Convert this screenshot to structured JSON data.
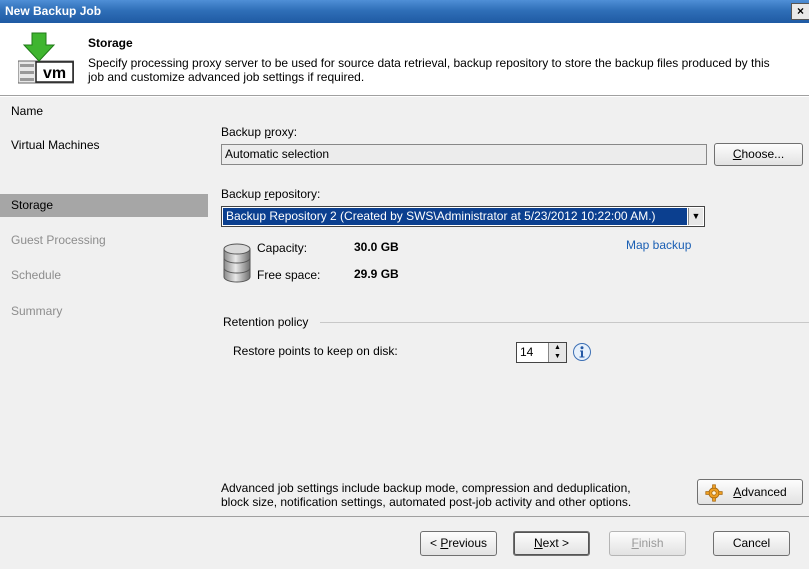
{
  "window": {
    "title": "New Backup Job",
    "close_label": "×"
  },
  "header": {
    "title": "Storage",
    "description_line1": "Specify processing proxy server to be used for source data retrieval, backup repository to store the backup files produced by this",
    "description_line2": "job and customize advanced job settings if required."
  },
  "nav": {
    "items": [
      {
        "label": "Name",
        "state": "normal"
      },
      {
        "label": "Virtual Machines",
        "state": "normal"
      },
      {
        "label": "Storage",
        "state": "active"
      },
      {
        "label": "Guest Processing",
        "state": "disabled"
      },
      {
        "label": "Schedule",
        "state": "disabled"
      },
      {
        "label": "Summary",
        "state": "disabled"
      }
    ]
  },
  "storage": {
    "proxy_label_pre": "Backup ",
    "proxy_label_u": "p",
    "proxy_label_post": "roxy:",
    "proxy_value": "Automatic selection",
    "choose_pre": "",
    "choose_u": "C",
    "choose_post": "hoose...",
    "repo_label_pre": "Backup ",
    "repo_label_u": "r",
    "repo_label_post": "epository:",
    "repo_selected": "Backup Repository 2 (Created by SWS\\Administrator at 5/23/2012 10:22:00 AM.)",
    "capacity_label": "Capacity:",
    "capacity_value": "30.0 GB",
    "free_label": "Free space:",
    "free_value": "29.9 GB",
    "map_backup": "Map backup"
  },
  "retention": {
    "group_label": "Retention policy",
    "points_label": "Restore points to keep on disk:",
    "points_value": "14"
  },
  "advanced": {
    "text_line1": "Advanced job settings include backup mode, compression and deduplication,",
    "text_line2": "block size, notification settings, automated post-job activity and other options.",
    "button_u": "A",
    "button_post": "dvanced"
  },
  "footer": {
    "previous_pre": "< ",
    "previous_u": "P",
    "previous_post": "revious",
    "next_u": "N",
    "next_post": "ext >",
    "finish_u": "F",
    "finish_post": "inish",
    "cancel": "Cancel"
  }
}
